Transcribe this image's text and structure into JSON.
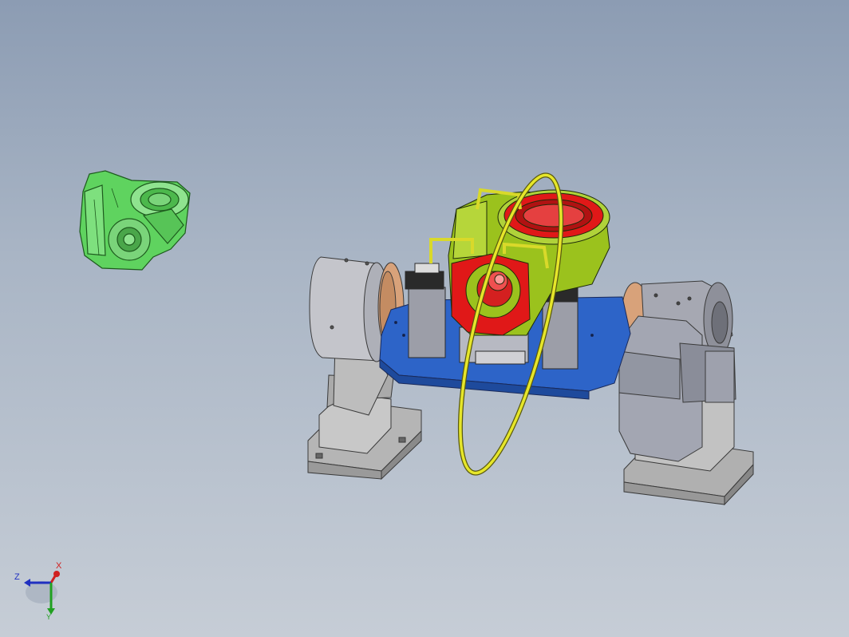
{
  "viewport": {
    "background_top": "#8c9cb3",
    "background_bottom": "#c6cdd6"
  },
  "parts": {
    "loose_part_color": "#5fd35f",
    "workpiece_red": "#e01818",
    "workpiece_green": "#9bc21d",
    "fixture_plate_color": "#2d64c8",
    "clamp_color": "#d9d92a",
    "ring_color": "#e6e62a",
    "housing_gray": "#9a9ca6",
    "disc_wood": "#d8a27a"
  },
  "triad": {
    "x_label": "X",
    "y_label": "Y",
    "z_label": "Z",
    "x_color": "#d02020",
    "y_color": "#20a020",
    "z_color": "#2030c0"
  }
}
